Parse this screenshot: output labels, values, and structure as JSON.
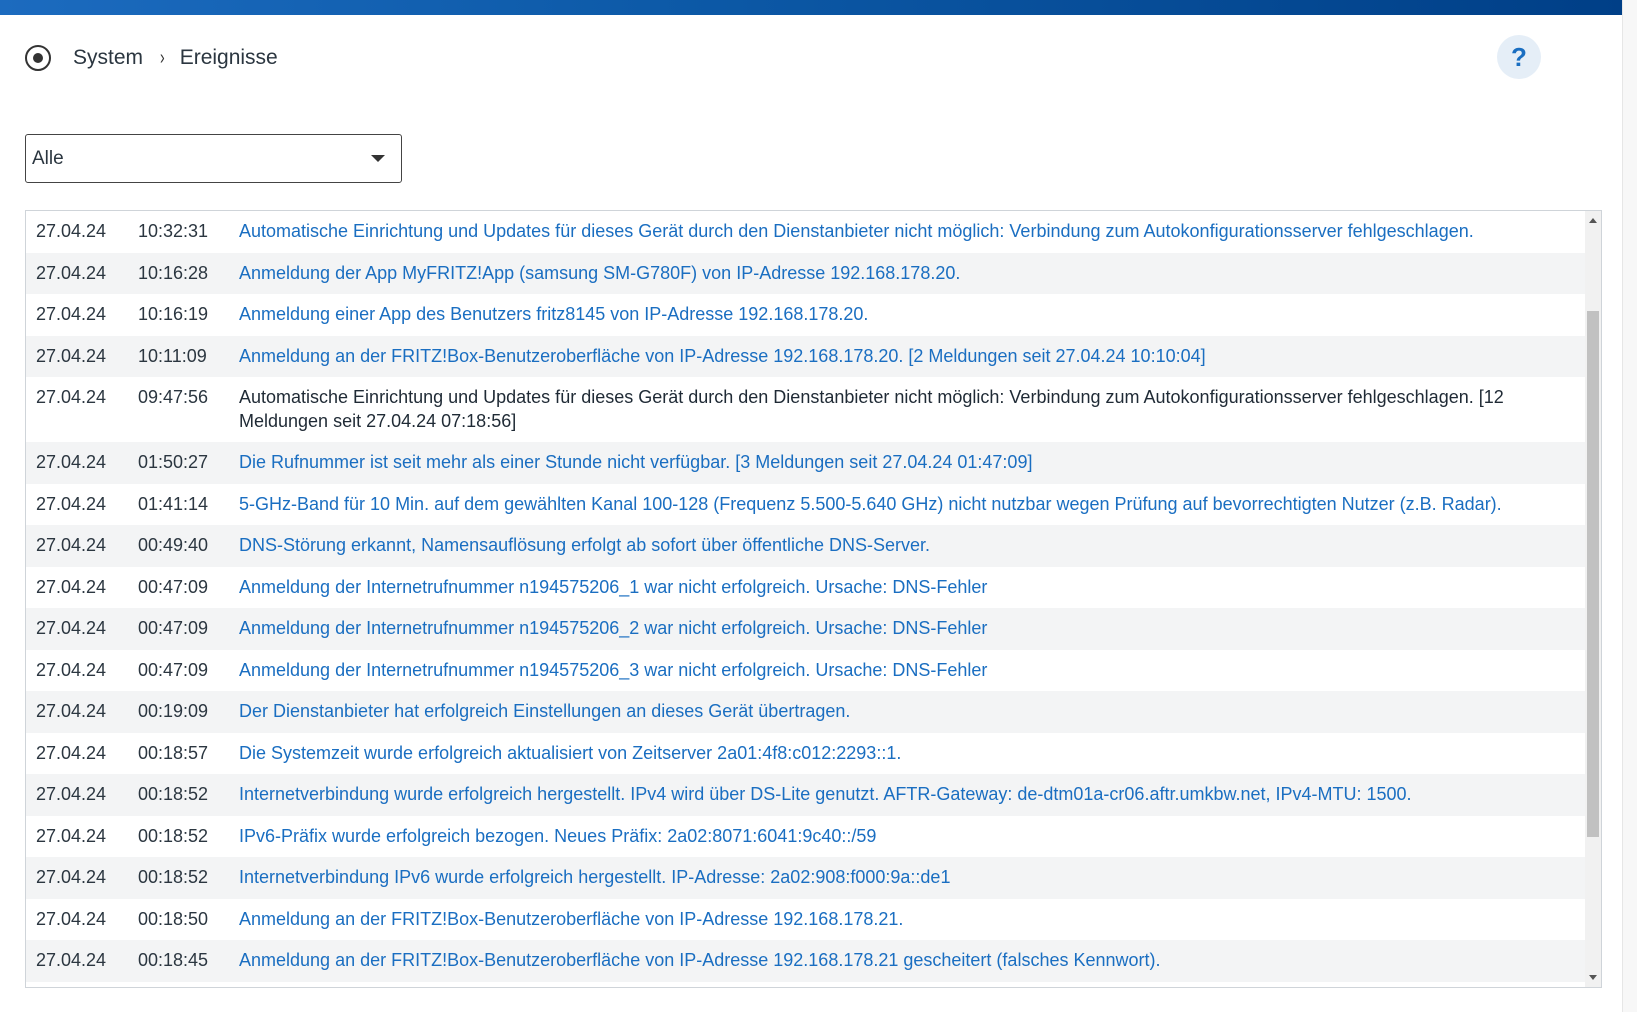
{
  "header": {
    "crumb_system": "System",
    "crumb_separator": "›",
    "crumb_current": "Ereignisse",
    "help_label": "?"
  },
  "filter": {
    "selected": "Alle"
  },
  "events": [
    {
      "date": "27.04.24",
      "time": "10:32:31",
      "message": "Automatische Einrichtung und Updates für dieses Gerät durch den Dienstanbieter nicht möglich: Verbindung zum Autokonfigurationsserver fehlgeschlagen."
    },
    {
      "date": "27.04.24",
      "time": "10:16:28",
      "message": "Anmeldung der App MyFRITZ!App (samsung SM-G780F) von IP-Adresse 192.168.178.20."
    },
    {
      "date": "27.04.24",
      "time": "10:16:19",
      "message": "Anmeldung einer App des Benutzers fritz8145 von IP-Adresse 192.168.178.20."
    },
    {
      "date": "27.04.24",
      "time": "10:11:09",
      "message": "Anmeldung an der FRITZ!Box-Benutzeroberfläche von IP-Adresse 192.168.178.20. [2 Meldungen seit 27.04.24 10:10:04]"
    },
    {
      "date": "27.04.24",
      "time": "09:47:56",
      "message": "Automatische Einrichtung und Updates für dieses Gerät durch den Dienstanbieter nicht möglich: Verbindung zum Autokonfigurationsserver fehlgeschlagen. [12 Meldungen seit 27.04.24 07:18:56]"
    },
    {
      "date": "27.04.24",
      "time": "01:50:27",
      "message": "Die Rufnummer ist seit mehr als einer Stunde nicht verfügbar. [3 Meldungen seit 27.04.24 01:47:09]"
    },
    {
      "date": "27.04.24",
      "time": "01:41:14",
      "message": "5-GHz-Band für 10 Min. auf dem gewählten Kanal 100-128 (Frequenz 5.500-5.640 GHz) nicht nutzbar wegen Prüfung auf bevorrechtigten Nutzer (z.B. Radar)."
    },
    {
      "date": "27.04.24",
      "time": "00:49:40",
      "message": "DNS-Störung erkannt, Namensauflösung erfolgt ab sofort über öffentliche DNS-Server."
    },
    {
      "date": "27.04.24",
      "time": "00:47:09",
      "message": "Anmeldung der Internetrufnummer n194575206_1 war nicht erfolgreich. Ursache: DNS-Fehler"
    },
    {
      "date": "27.04.24",
      "time": "00:47:09",
      "message": "Anmeldung der Internetrufnummer n194575206_2 war nicht erfolgreich. Ursache: DNS-Fehler"
    },
    {
      "date": "27.04.24",
      "time": "00:47:09",
      "message": "Anmeldung der Internetrufnummer n194575206_3 war nicht erfolgreich. Ursache: DNS-Fehler"
    },
    {
      "date": "27.04.24",
      "time": "00:19:09",
      "message": "Der Dienstanbieter hat erfolgreich Einstellungen an dieses Gerät übertragen."
    },
    {
      "date": "27.04.24",
      "time": "00:18:57",
      "message": "Die Systemzeit wurde erfolgreich aktualisiert von Zeitserver 2a01:4f8:c012:2293::1."
    },
    {
      "date": "27.04.24",
      "time": "00:18:52",
      "message": "Internetverbindung wurde erfolgreich hergestellt. IPv4 wird über DS-Lite genutzt. AFTR-Gateway: de-dtm01a-cr06.aftr.umkbw.net, IPv4-MTU: 1500."
    },
    {
      "date": "27.04.24",
      "time": "00:18:52",
      "message": "IPv6-Präfix wurde erfolgreich bezogen. Neues Präfix: 2a02:8071:6041:9c40::/59"
    },
    {
      "date": "27.04.24",
      "time": "00:18:52",
      "message": "Internetverbindung IPv6 wurde erfolgreich hergestellt. IP-Adresse: 2a02:908:f000:9a::de1"
    },
    {
      "date": "27.04.24",
      "time": "00:18:50",
      "message": "Anmeldung an der FRITZ!Box-Benutzeroberfläche von IP-Adresse 192.168.178.21."
    },
    {
      "date": "27.04.24",
      "time": "00:18:45",
      "message": "Anmeldung an der FRITZ!Box-Benutzeroberfläche von IP-Adresse 192.168.178.21 gescheitert (falsches Kennwort)."
    }
  ],
  "colors": {
    "link": "#1a6ec1",
    "topbar": "#0d5aa8",
    "row_alt": "#f3f4f5"
  }
}
